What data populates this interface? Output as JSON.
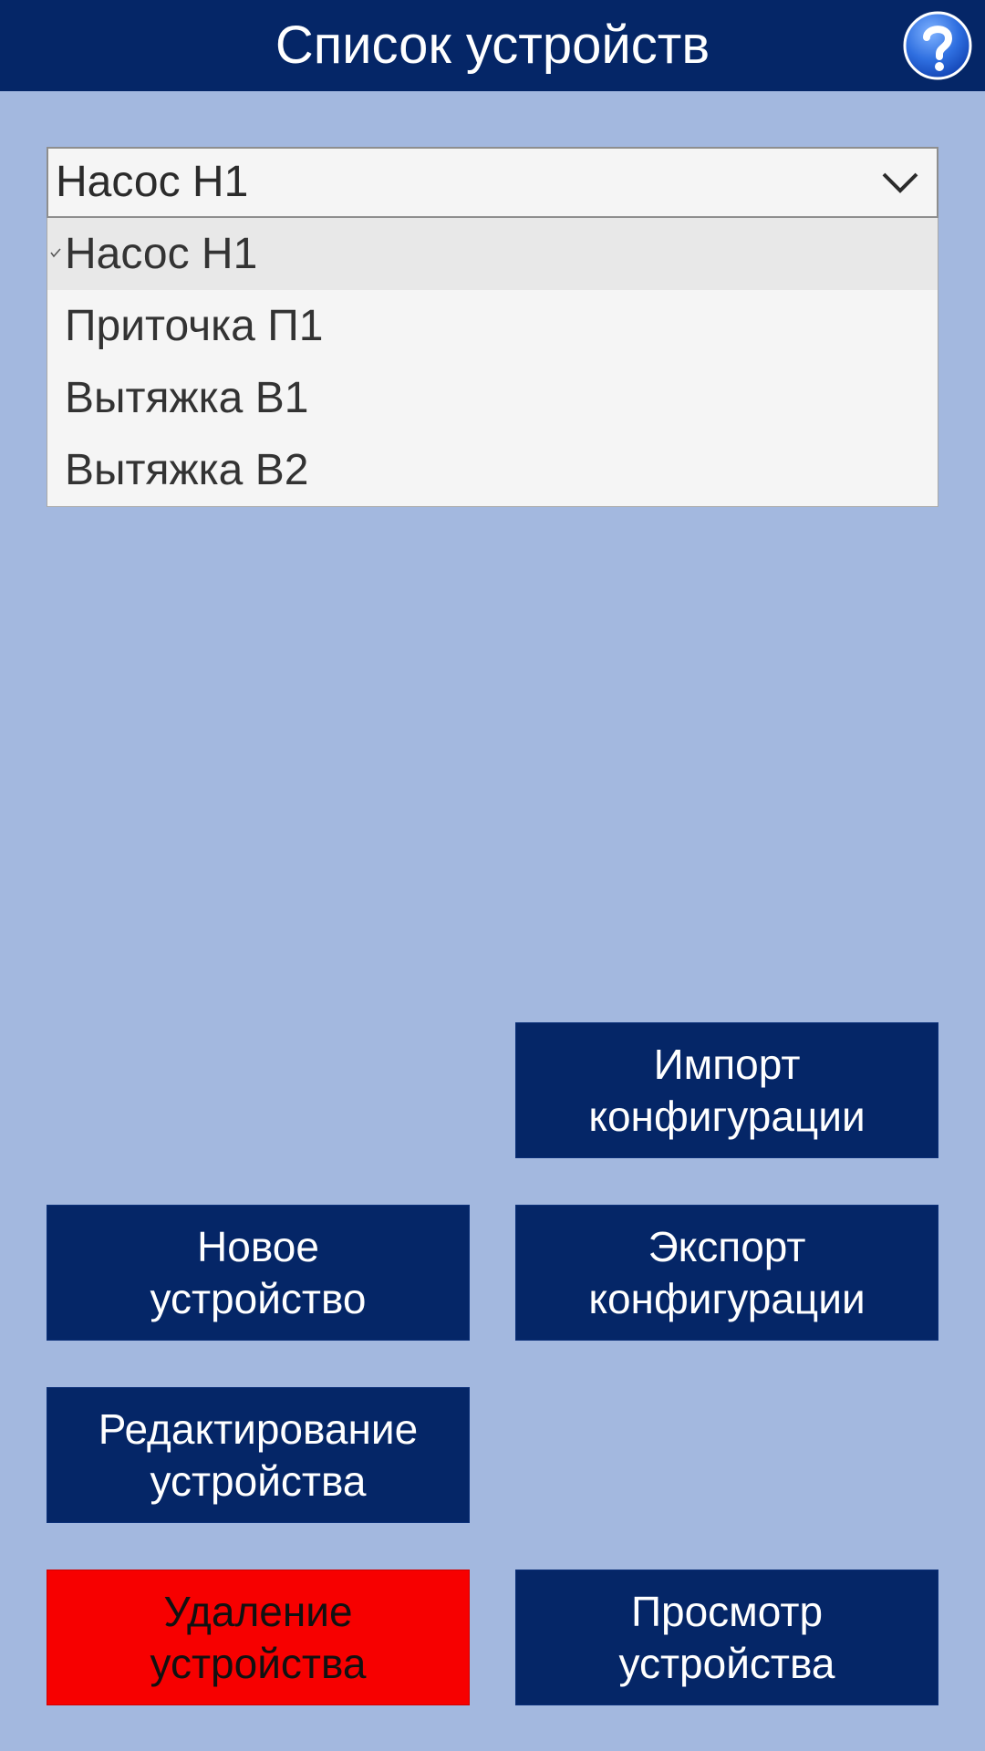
{
  "header": {
    "title": "Список устройств",
    "help_icon": "question-mark-icon"
  },
  "device_select": {
    "value": "Насос Н1",
    "options": [
      "Насос Н1",
      "Приточка П1",
      "Вытяжка В1",
      "Вытяжка В2"
    ],
    "selected_index": 0
  },
  "buttons": {
    "import_config": {
      "line1": "Импорт",
      "line2": "конфигурации"
    },
    "new_device": {
      "line1": "Новое",
      "line2": "устройство"
    },
    "export_config": {
      "line1": "Экспорт",
      "line2": "конфигурации"
    },
    "edit_device": {
      "line1": "Редактирование",
      "line2": "устройства"
    },
    "delete_device": {
      "line1": "Удаление",
      "line2": "устройства"
    },
    "view_device": {
      "line1": "Просмотр",
      "line2": "устройства"
    }
  },
  "colors": {
    "background": "#a3b8df",
    "header": "#052667",
    "button": "#052667",
    "danger": "#f70000"
  }
}
